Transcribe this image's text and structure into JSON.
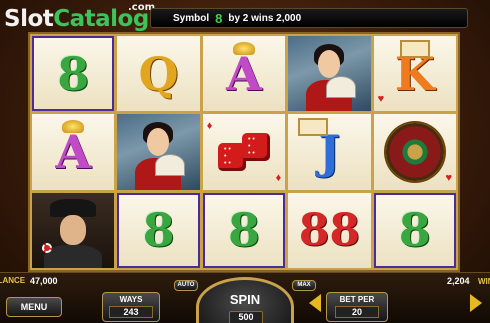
{
  "logo": {
    "slot": "Slot",
    "catalog": "Catalog",
    "com": ".com"
  },
  "win_banner": {
    "prefix": "Symbol",
    "symbol": "8",
    "suffix": "by 2 wins 2,000"
  },
  "reels": [
    [
      {
        "type": "eight",
        "text": "8",
        "win": true
      },
      {
        "type": "letter-a",
        "text": "A",
        "win": false
      },
      {
        "type": "gangster",
        "text": "",
        "win": false
      }
    ],
    [
      {
        "type": "letter-q",
        "text": "Q",
        "win": false
      },
      {
        "type": "lady",
        "text": "",
        "win": false
      },
      {
        "type": "eight",
        "text": "8",
        "win": true
      }
    ],
    [
      {
        "type": "letter-a",
        "text": "A",
        "win": false
      },
      {
        "type": "dice",
        "text": "",
        "win": false
      },
      {
        "type": "eight",
        "text": "8",
        "win": true
      }
    ],
    [
      {
        "type": "lady",
        "text": "",
        "win": true
      },
      {
        "type": "letter-j",
        "text": "J",
        "win": false
      },
      {
        "type": "double8",
        "text": "88",
        "win": false
      }
    ],
    [
      {
        "type": "letter-k",
        "text": "K",
        "win": false
      },
      {
        "type": "roulette",
        "text": "",
        "win": false
      },
      {
        "type": "eight",
        "text": "8",
        "win": true
      }
    ]
  ],
  "balance": {
    "label": "BALANCE",
    "value": "47,000"
  },
  "win": {
    "label": "WIN",
    "value": "2,204"
  },
  "buttons": {
    "menu": "MENU",
    "ways_label": "WAYS",
    "ways_value": "243",
    "auto": "AUTO",
    "spin": "SPIN",
    "spin_value": "500",
    "max": "MAX",
    "bet_per_label": "BET PER",
    "bet_per_value": "20"
  }
}
